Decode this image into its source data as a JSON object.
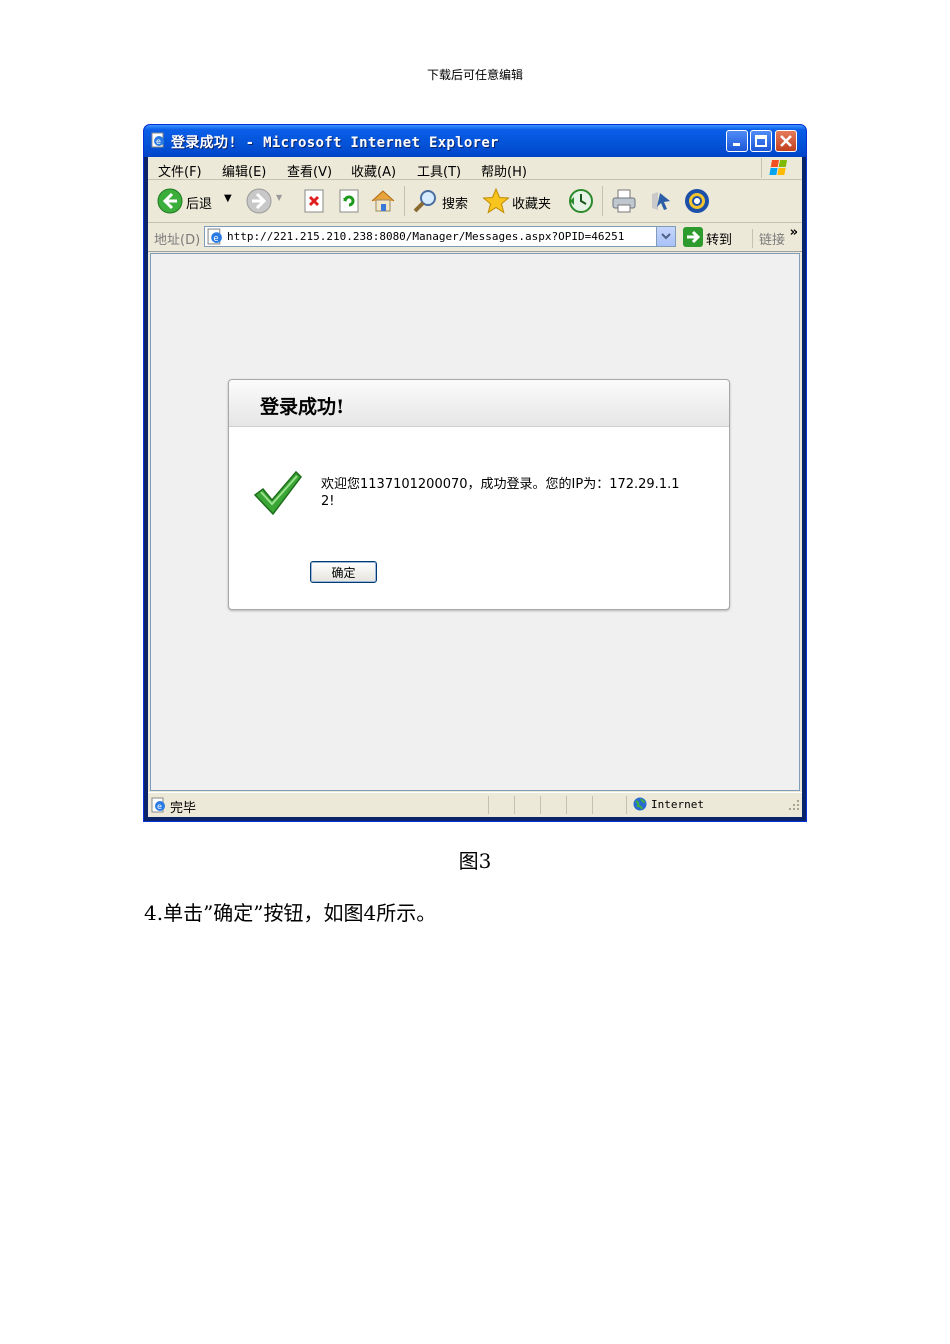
{
  "header_note": "下载后可任意编辑",
  "window": {
    "title": "登录成功! - Microsoft Internet Explorer",
    "menu": [
      "文件(F)",
      "编辑(E)",
      "查看(V)",
      "收藏(A)",
      "工具(T)",
      "帮助(H)"
    ],
    "toolbar": {
      "back_label": "后退",
      "search_label": "搜索",
      "favorites_label": "收藏夹"
    },
    "address": {
      "label": "地址(D)",
      "url": "http://221.215.210.238:8080/Manager/Messages.aspx?OPID=46251",
      "go_label": "转到",
      "links_label": "链接"
    },
    "dialog": {
      "title": "登录成功!",
      "message": "欢迎您1137101200070，成功登录。您的IP为：172.29.1.12!",
      "ok_label": "确定"
    },
    "status": {
      "text": "完毕",
      "zone": "Internet"
    }
  },
  "caption": "图3",
  "instruction": "4.单击”确定”按钮，如图4所示。",
  "colors": {
    "titlebar": "#0453d8",
    "client": "#ece9d8",
    "check_green": "#3aa635"
  }
}
